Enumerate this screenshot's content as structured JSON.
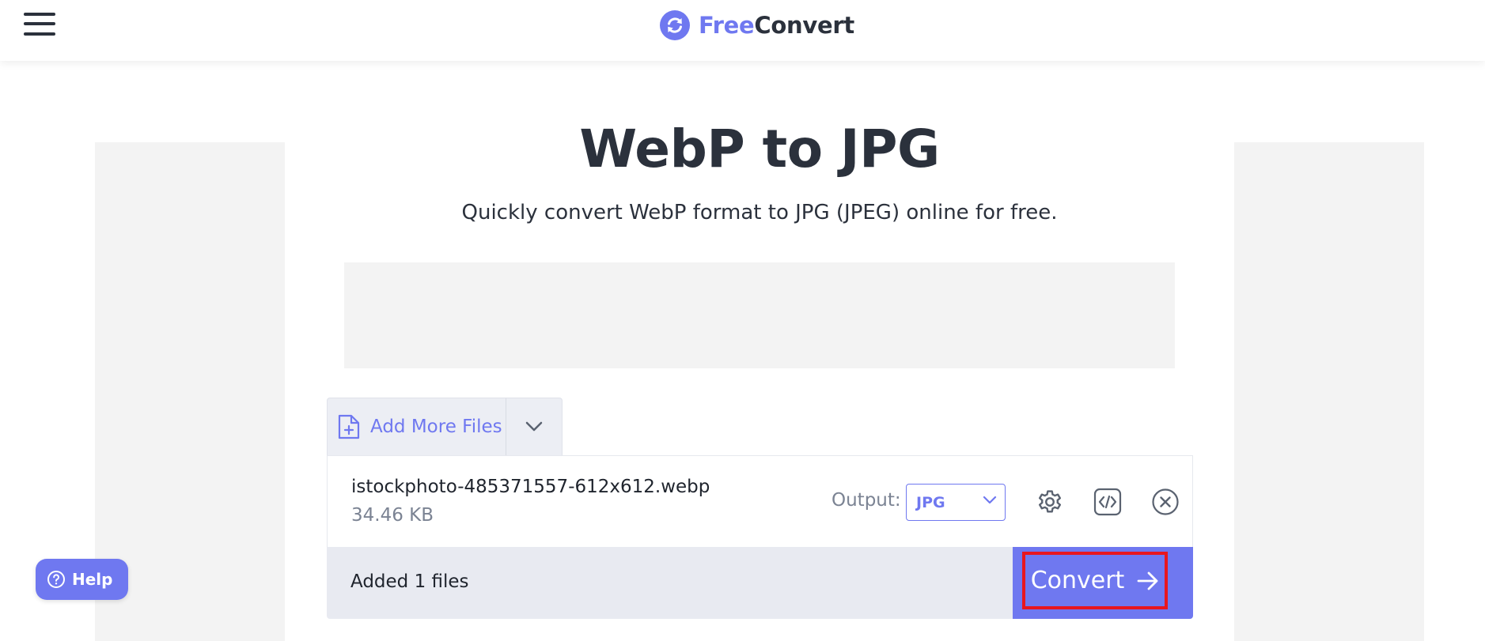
{
  "header": {
    "brand_part1": "Free",
    "brand_part2": "Convert",
    "menu_icon": "hamburger-menu-icon",
    "logo_icon": "refresh-arrows-icon"
  },
  "hero": {
    "title": "WebP to JPG",
    "subtitle": "Quickly convert WebP format to JPG (JPEG) online for free."
  },
  "uploader": {
    "add_more_label": "Add More Files",
    "add_icon": "file-plus-icon",
    "dropdown_icon": "chevron-down-icon",
    "file": {
      "name": "istockphoto-485371557-612x612.webp",
      "size": "34.46 KB",
      "output_label": "Output:",
      "output_value": "JPG",
      "actions": [
        "gear-icon",
        "code-icon",
        "close-circle-icon"
      ]
    },
    "files_count": "Added 1 files",
    "convert_label": "Convert",
    "convert_icon": "arrow-right-icon"
  },
  "help": {
    "label": "Help",
    "icon": "question-circle-icon"
  },
  "colors": {
    "accent": "#6f78f0",
    "text_dark": "#2b313c",
    "text_muted": "#7b8393",
    "footer_bg": "#e8eaf1",
    "highlight_border": "#e8161f",
    "ad_placeholder": "#f3f3f3"
  }
}
